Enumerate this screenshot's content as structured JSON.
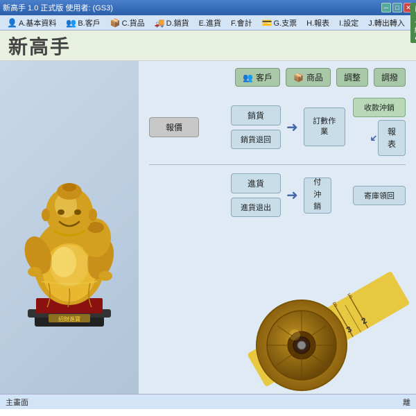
{
  "window": {
    "title": "新高手 1.0 正式版  使用者: (GS3)",
    "controls": {
      "min": "－",
      "max": "□",
      "close": "✕"
    },
    "online_badge": "已上線●"
  },
  "menubar": {
    "items": [
      {
        "key": "A",
        "label": "A.基本資料",
        "icon": "👤"
      },
      {
        "key": "B",
        "label": "B.客戶",
        "icon": "👥"
      },
      {
        "key": "C",
        "label": "C.貨品",
        "icon": "📦"
      },
      {
        "key": "D",
        "label": "D.銷貨",
        "icon": "🚚"
      },
      {
        "key": "E",
        "label": "E.進貨",
        "icon": ""
      },
      {
        "key": "F",
        "label": "F.會計",
        "icon": ""
      },
      {
        "key": "G",
        "label": "G.支票",
        "icon": "💳"
      },
      {
        "key": "H",
        "label": "H.報表",
        "icon": ""
      },
      {
        "key": "I",
        "label": "I.設定",
        "icon": ""
      },
      {
        "key": "J",
        "label": "J.轉出轉入",
        "icon": ""
      }
    ]
  },
  "logo": {
    "text": "新高手"
  },
  "top_buttons": [
    {
      "id": "customer",
      "label": "客戶",
      "icon": "👥"
    },
    {
      "id": "goods",
      "label": "商品",
      "icon": "📦"
    },
    {
      "id": "adjust",
      "label": "調整",
      "icon": ""
    },
    {
      "id": "adjust2",
      "label": "調撥",
      "icon": ""
    }
  ],
  "workflow": {
    "quote": "報價",
    "sale": "銷貨",
    "sale_return": "銷貨退回",
    "order": "訂數作業",
    "receive_offset": "收款沖銷",
    "report": "報\n表",
    "purchase": "進貨",
    "purchase_return": "進貨退出",
    "pay_offset": "付\n沖\n銷",
    "warehouse_return": "寄庫領回"
  },
  "statusbar": {
    "label": "主畫面",
    "right_text": "離"
  },
  "colors": {
    "bg": "#e0eaf5",
    "box_blue": "#c8dde8",
    "box_green": "#b8d8b8",
    "box_gray": "#c8c8c8",
    "menubar": "#d4e4f7"
  }
}
